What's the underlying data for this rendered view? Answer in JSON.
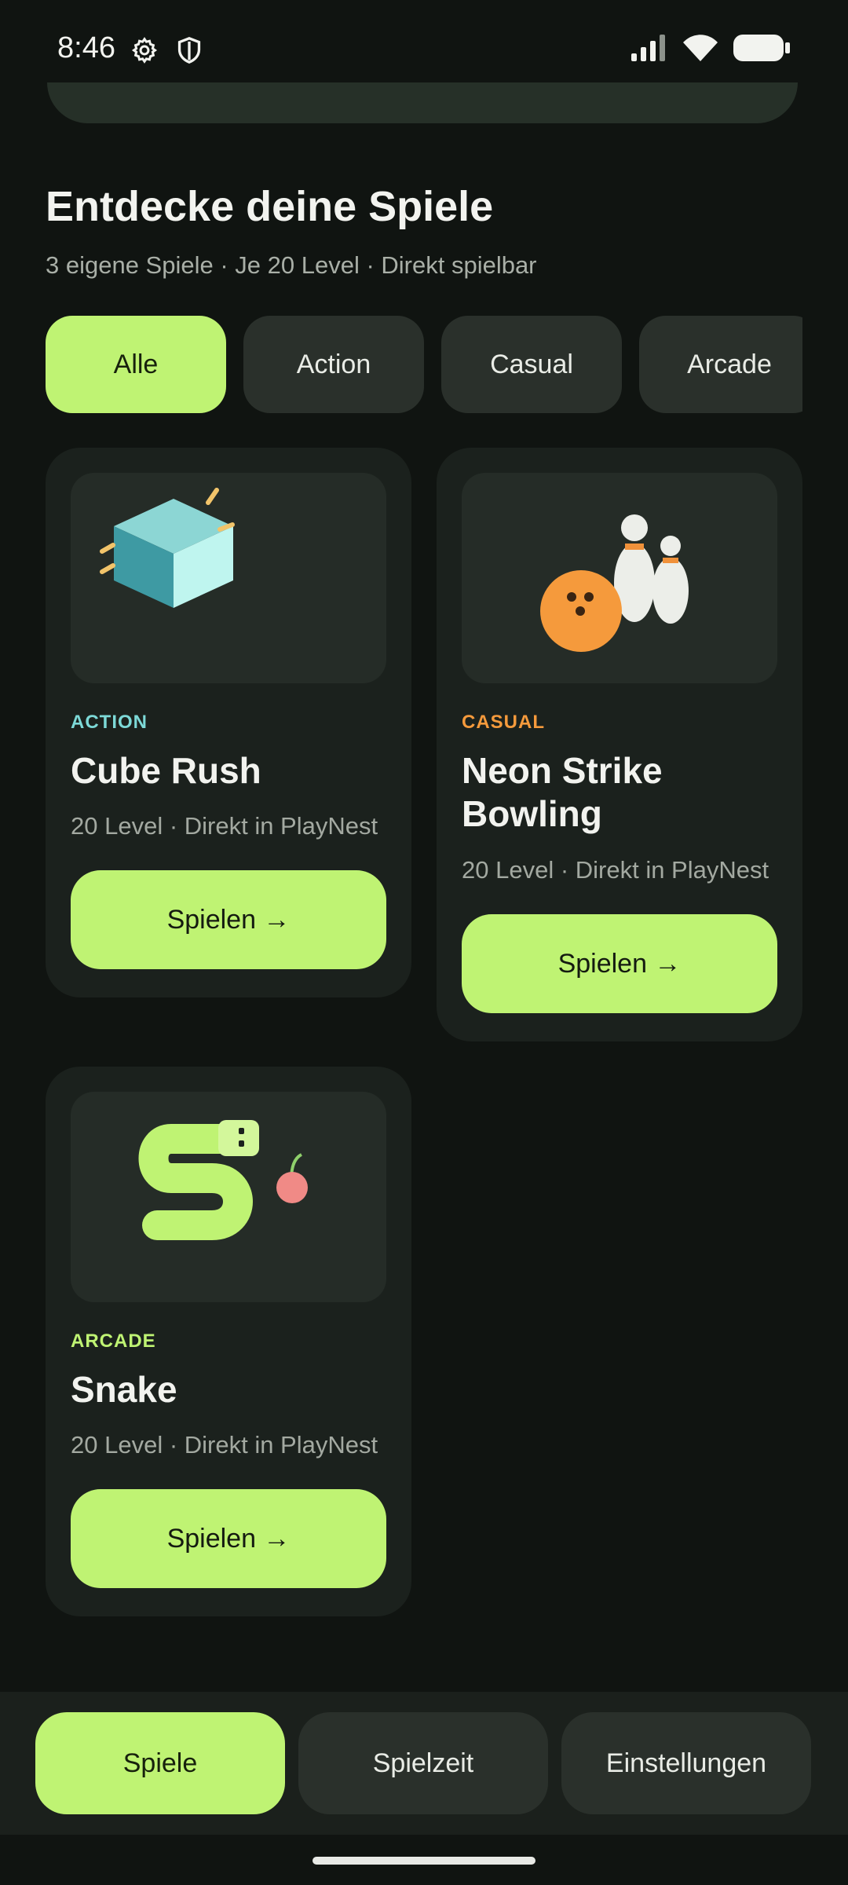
{
  "status": {
    "time": "8:46"
  },
  "discover": {
    "title": "Entdecke deine Spiele",
    "subtitle": "3 eigene Spiele · Je 20 Level · Direkt spielbar"
  },
  "filters": [
    {
      "label": "Alle",
      "selected": true
    },
    {
      "label": "Action",
      "selected": false
    },
    {
      "label": "Casual",
      "selected": false
    },
    {
      "label": "Arcade",
      "selected": false
    }
  ],
  "games": [
    {
      "category": "ACTION",
      "category_color": "#7DD9D7",
      "title": "Cube Rush",
      "meta": "20 Level · Direkt in PlayNest",
      "play_label": "Spielen  →",
      "icon": "cube-icon"
    },
    {
      "category": "CASUAL",
      "category_color": "#F59A3C",
      "title": "Neon Strike Bowling",
      "meta": "20 Level · Direkt in PlayNest",
      "play_label": "Spielen  →",
      "icon": "bowling-icon"
    },
    {
      "category": "ARCADE",
      "category_color": "#BFF373",
      "title": "Snake",
      "meta": "20 Level · Direkt in PlayNest",
      "play_label": "Spielen  →",
      "icon": "snake-icon"
    }
  ],
  "nav": [
    {
      "label": "Spiele",
      "selected": true
    },
    {
      "label": "Spielzeit",
      "selected": false
    },
    {
      "label": "Einstellungen",
      "selected": false
    }
  ],
  "colors": {
    "accent": "#BFF373",
    "background": "#101411",
    "card": "#1B211D"
  }
}
